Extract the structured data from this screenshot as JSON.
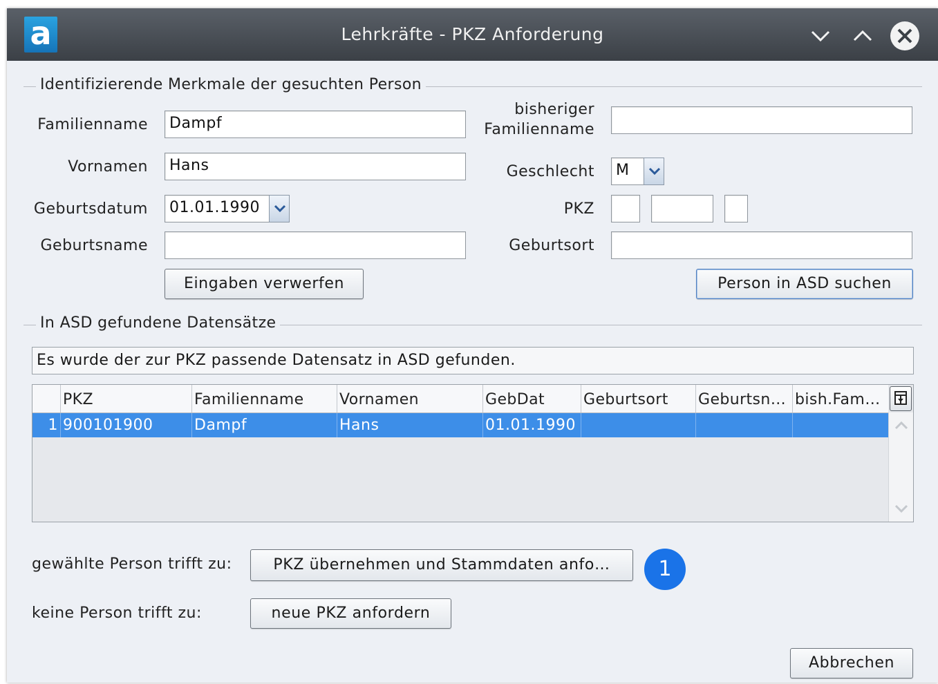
{
  "window": {
    "title": "Lehrkräfte - PKZ Anforderung",
    "logo_letter": "a"
  },
  "search_section": {
    "title": "Identifizierende Merkmale der gesuchten Person",
    "familienname_label": "Familienname",
    "familienname_value": "Dampf",
    "vornamen_label": "Vornamen",
    "vornamen_value": "Hans",
    "geburtsdatum_label": "Geburtsdatum",
    "geburtsdatum_value": "01.01.1990",
    "geburtsname_label": "Geburtsname",
    "geburtsname_value": "",
    "bisheriger_label_line1": "bisheriger",
    "bisheriger_label_line2": "Familienname",
    "bisheriger_value": "",
    "geschlecht_label": "Geschlecht",
    "geschlecht_value": "M",
    "pkz_label": "PKZ",
    "pkz_part1": "",
    "pkz_part2": "",
    "pkz_part3": "",
    "geburtsort_label": "Geburtsort",
    "geburtsort_value": "",
    "discard_button": "Eingaben verwerfen",
    "search_button": "Person in ASD suchen"
  },
  "results_section": {
    "title": "In ASD gefundene Datensätze",
    "status_message": "Es wurde der zur PKZ passende Datensatz in ASD gefunden.",
    "columns": [
      "PKZ",
      "Familienname",
      "Vornamen",
      "GebDat",
      "Geburtsort",
      "Geburtsn…",
      "bish.Fam…"
    ],
    "rows": [
      {
        "index": "1",
        "pkz": "900101900",
        "familienname": "Dampf",
        "vornamen": "Hans",
        "gebdat": "01.01.1990",
        "geburtsort": "",
        "geburtsname": "",
        "bish_fam": ""
      }
    ]
  },
  "actions": {
    "matches_label": "gewählte Person trifft zu:",
    "matches_button": "PKZ übernehmen und Stammdaten anfo…",
    "badge": "1",
    "none_label": "keine Person trifft zu:",
    "none_button": "neue PKZ anfordern",
    "cancel_button": "Abbrechen"
  },
  "colors": {
    "titlebar": "#3b4046",
    "selection": "#3d8ee8",
    "badge": "#1a73e8",
    "background": "#edf0f5"
  }
}
